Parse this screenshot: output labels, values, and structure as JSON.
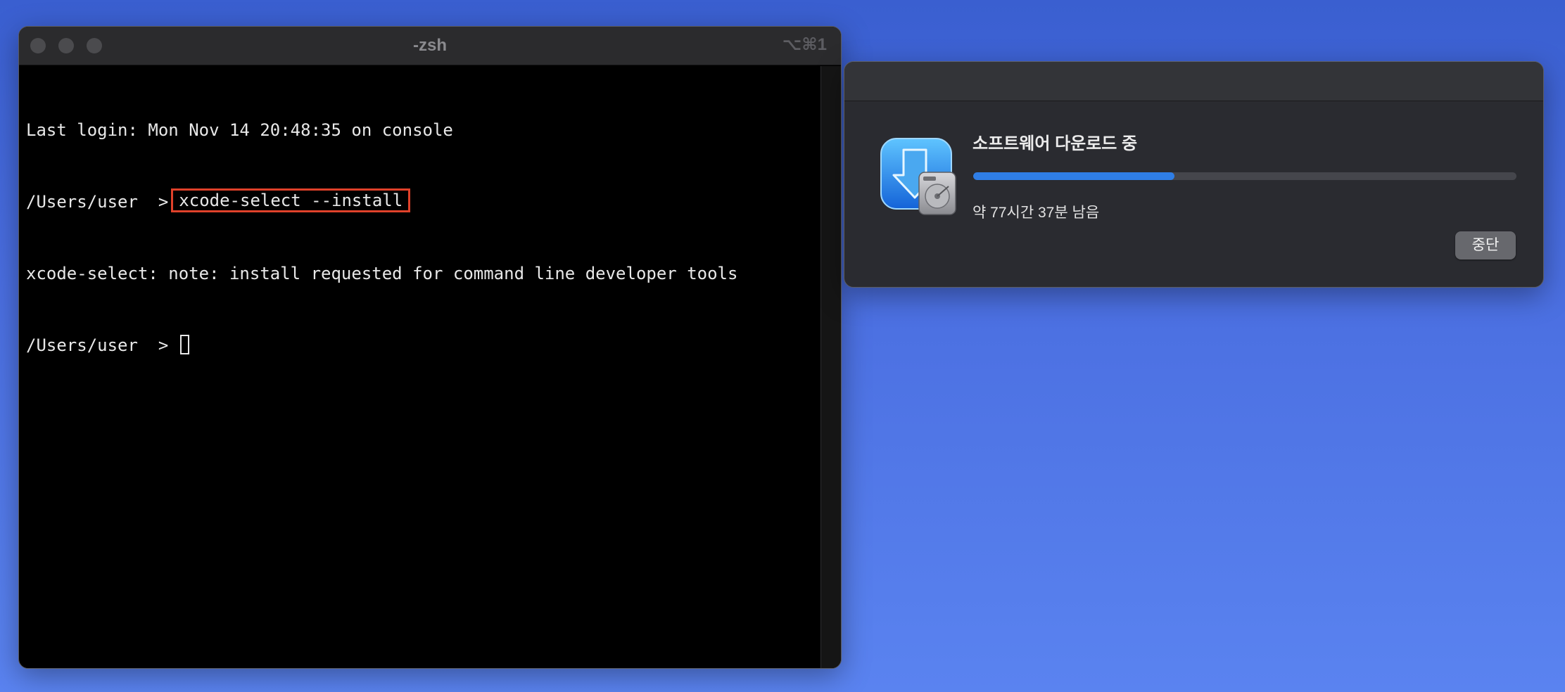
{
  "terminal": {
    "title": "-zsh",
    "shortcut": "⌥⌘1",
    "lines": {
      "login": "Last login: Mon Nov 14 20:48:35 on console",
      "prompt1": "/Users/user  >",
      "command": "xcode-select --install",
      "note": "xcode-select: note: install requested for command line developer tools",
      "prompt2": "/Users/user  >"
    }
  },
  "dialog": {
    "icon": "xcode-installer-icon",
    "title": "소프트웨어 다운로드 중",
    "progress": 0.37,
    "status": "약 77시간 37분 남음",
    "stop_label": "중단"
  },
  "colors": {
    "highlight_box": "#e0412a",
    "progress_fill": "#2f7ee6",
    "desktop_top": "#3a5fd0",
    "desktop_bottom": "#5a83f0"
  }
}
